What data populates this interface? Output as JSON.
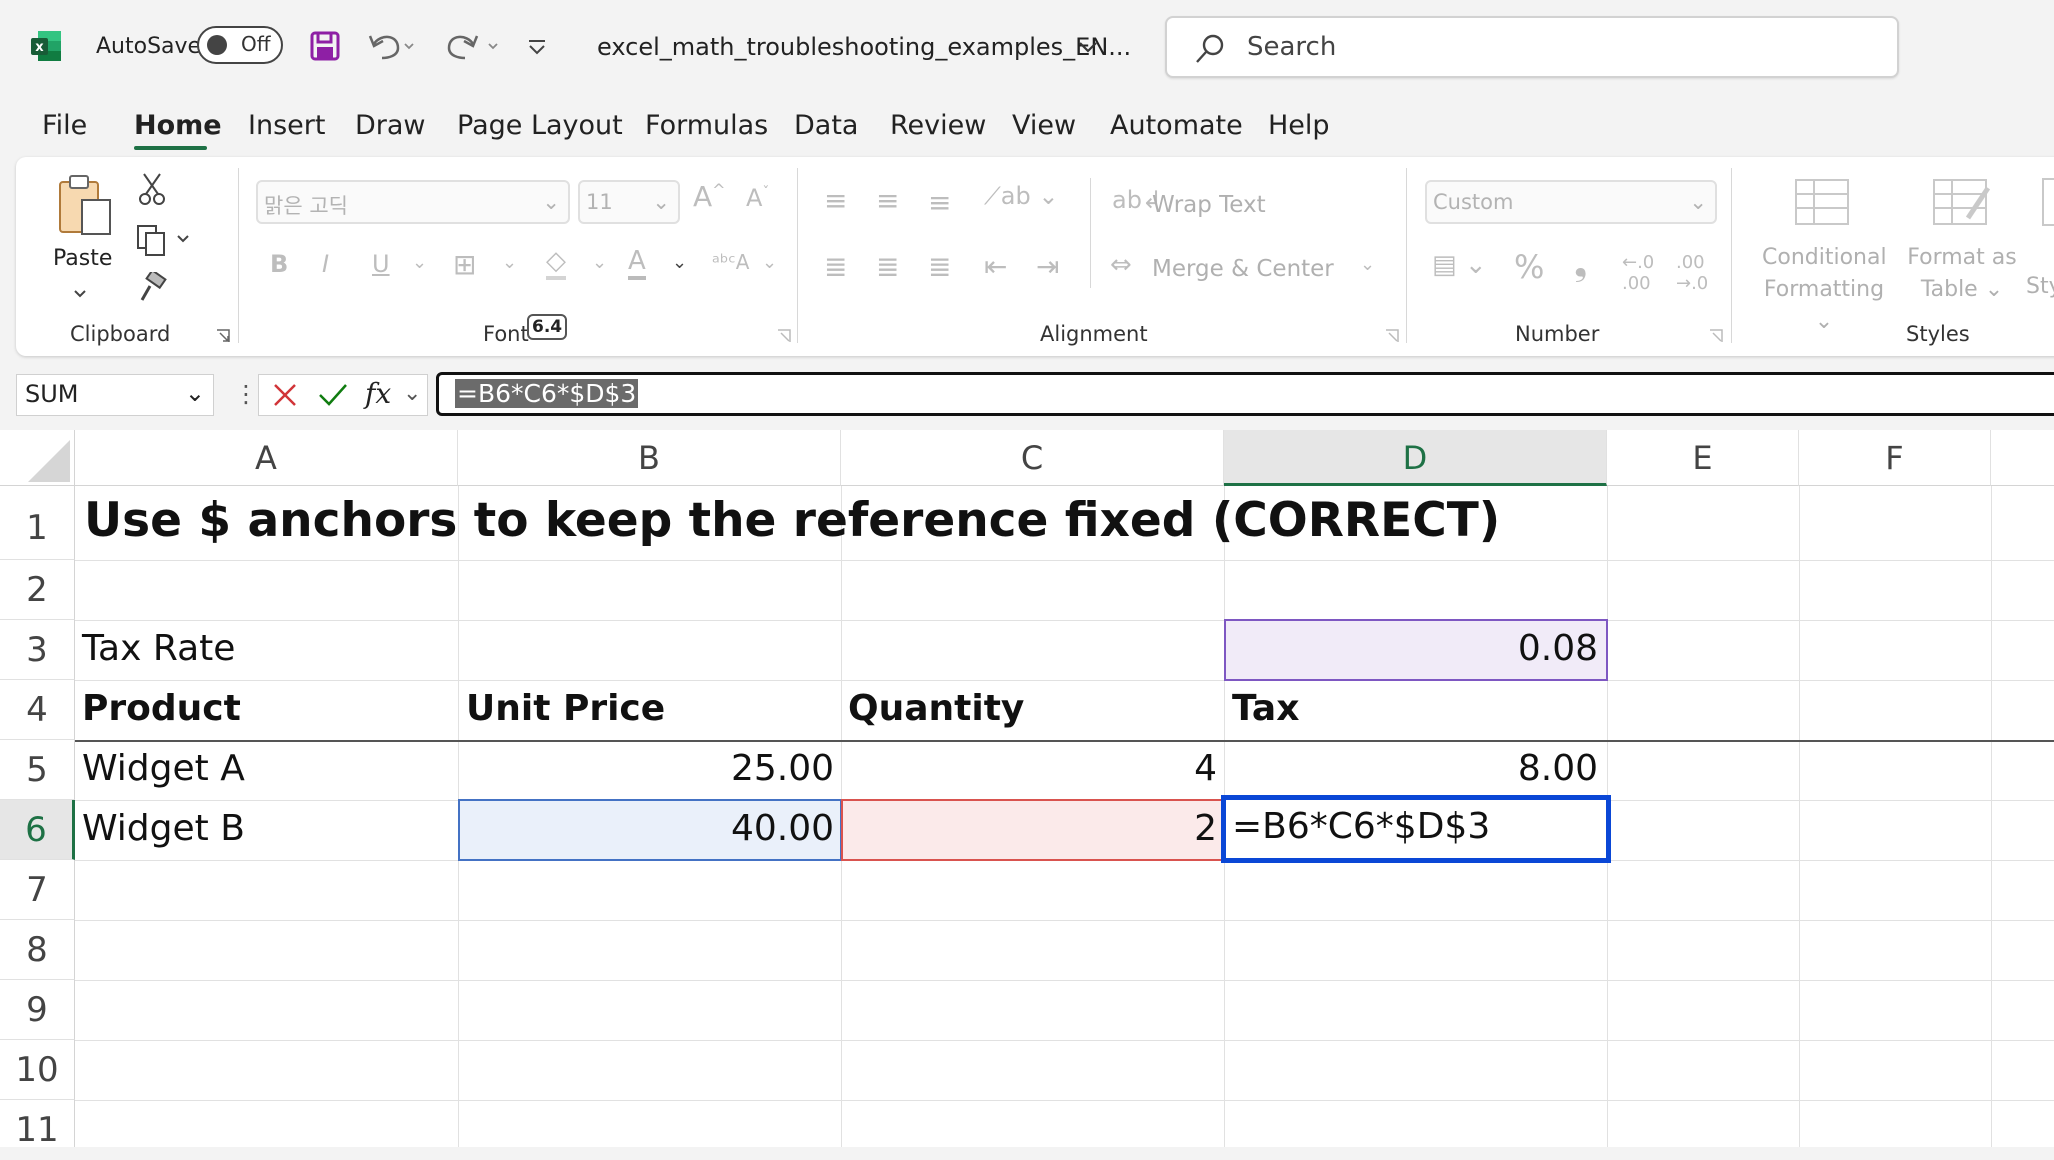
{
  "titlebar": {
    "autosave_label": "AutoSave",
    "autosave_state": "Off",
    "file_title": "excel_math_troubleshooting_examples_EN...",
    "search_placeholder": "Search"
  },
  "menu": {
    "tabs": [
      "File",
      "Home",
      "Insert",
      "Draw",
      "Page Layout",
      "Formulas",
      "Data",
      "Review",
      "View",
      "Automate",
      "Help"
    ],
    "active": "Home"
  },
  "ribbon": {
    "clipboard": {
      "paste_label": "Paste",
      "group_label": "Clipboard"
    },
    "font": {
      "font_name": "맑은 고딕",
      "font_size": "11",
      "group_label": "Font",
      "badge": "6.4"
    },
    "alignment": {
      "wrap_text": "Wrap Text",
      "merge_center": "Merge & Center",
      "group_label": "Alignment"
    },
    "number": {
      "format": "Custom",
      "group_label": "Number"
    },
    "styles": {
      "conditional": "Conditional",
      "formatting": "Formatting",
      "format_as": "Format as",
      "table": "Table",
      "cell_styles_partial": "Sty",
      "group_label": "Styles"
    }
  },
  "formula_bar": {
    "name_box": "SUM",
    "formula": "=B6*C6*$D$3"
  },
  "sheet": {
    "columns": [
      "A",
      "B",
      "C",
      "D",
      "E",
      "F"
    ],
    "selected_column": "D",
    "rows": [
      "1",
      "2",
      "3",
      "4",
      "5",
      "6",
      "7",
      "8",
      "9",
      "10",
      "11"
    ],
    "selected_row": "6",
    "cells": {
      "A1": "Use $ anchors to keep the reference fixed (CORRECT)",
      "A3": "Tax Rate",
      "D3": "0.08",
      "A4": "Product",
      "B4": "Unit Price",
      "C4": "Quantity",
      "D4": "Tax",
      "A5": "Widget A",
      "B5": "25.00",
      "C5": "4",
      "D5": "8.00",
      "A6": "Widget B",
      "B6": "40.00",
      "C6": "2",
      "D6": "=B6*C6*$D$3"
    },
    "colors": {
      "ref_D3": "#7e57c2",
      "ref_B6": "#4472c4",
      "ref_C6": "#d9534f",
      "active_cell_border": "#0a47d6",
      "accent_green": "#1e7145"
    }
  }
}
